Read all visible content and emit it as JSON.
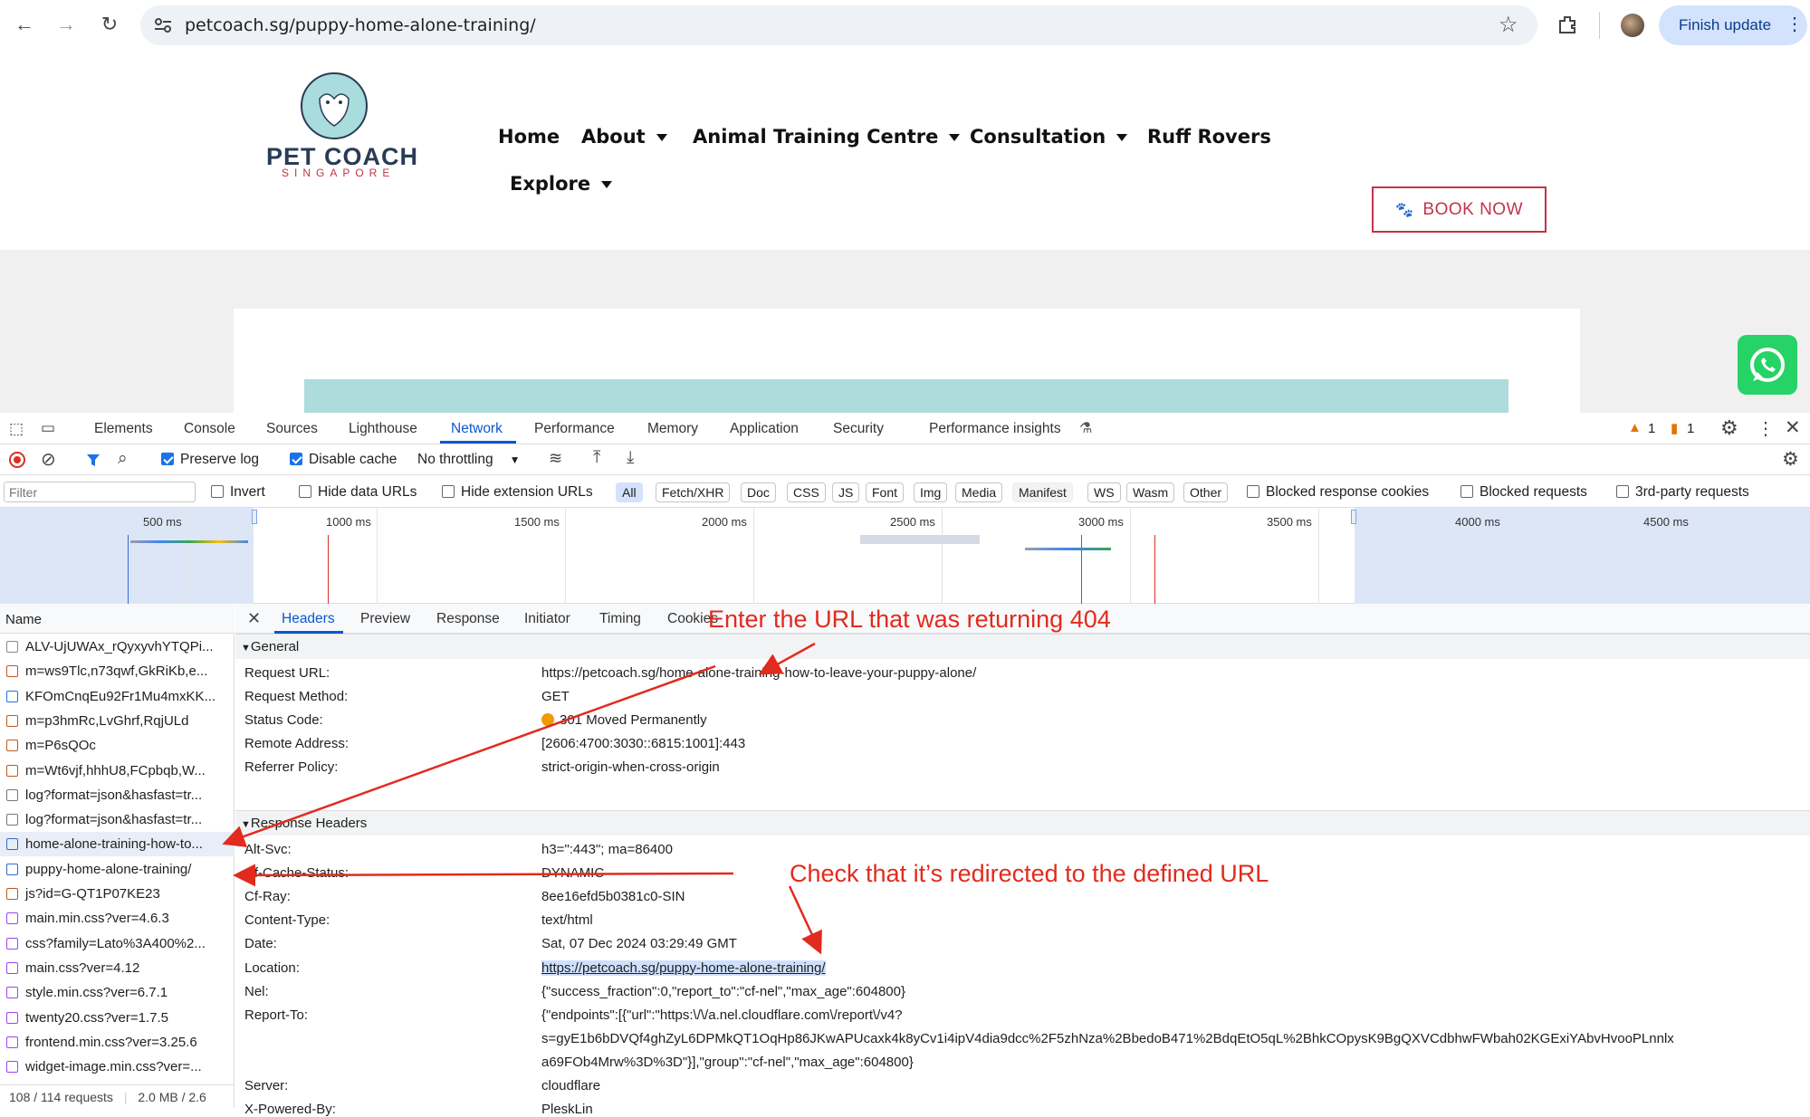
{
  "browser": {
    "url": "petcoach.sg/puppy-home-alone-training/",
    "finish_update_label": "Finish update"
  },
  "site": {
    "logo_text": "PET COACH",
    "logo_subtext": "SINGAPORE",
    "menu": [
      "Home",
      "About",
      "Animal Training Centre",
      "Consultation",
      "Ruff Rovers",
      "Explore"
    ],
    "book_now_label": "BOOK NOW"
  },
  "devtools": {
    "tabs": [
      "Elements",
      "Console",
      "Sources",
      "Lighthouse",
      "Network",
      "Performance",
      "Memory",
      "Application",
      "Security",
      "Performance insights"
    ],
    "active_tab": "Network",
    "warning_count": "1",
    "issue_count": "1",
    "preserve_log_label": "Preserve log",
    "disable_cache_label": "Disable cache",
    "throttling_label": "No throttling",
    "filter_placeholder": "Filter",
    "invert_label": "Invert",
    "hide_data_urls_label": "Hide data URLs",
    "hide_extension_urls_label": "Hide extension URLs",
    "type_filters": [
      "All",
      "Fetch/XHR",
      "Doc",
      "CSS",
      "JS",
      "Font",
      "Img",
      "Media",
      "Manifest",
      "WS",
      "Wasm",
      "Other"
    ],
    "blocked_cookies_label": "Blocked response cookies",
    "blocked_requests_label": "Blocked requests",
    "third_party_label": "3rd-party requests",
    "timeline_ticks": [
      "500 ms",
      "1000 ms",
      "1500 ms",
      "2000 ms",
      "2500 ms",
      "3000 ms",
      "3500 ms",
      "4000 ms",
      "4500 ms"
    ],
    "name_header": "Name",
    "requests": [
      "ALV-UjUWAx_rQyxyvhYTQPi...",
      "m=ws9Tlc,n73qwf,GkRiKb,e...",
      "KFOmCnqEu92Fr1Mu4mxKK...",
      "m=p3hmRc,LvGhrf,RqjULd",
      "m=P6sQOc",
      "m=Wt6vjf,hhhU8,FCpbqb,W...",
      "log?format=json&hasfast=tr...",
      "log?format=json&hasfast=tr...",
      "home-alone-training-how-to...",
      "puppy-home-alone-training/",
      "js?id=G-QT1P07KE23",
      "main.min.css?ver=4.6.3",
      "css?family=Lato%3A400%2...",
      "main.css?ver=4.12",
      "style.min.css?ver=6.7.1",
      "twenty20.css?ver=1.7.5",
      "frontend.min.css?ver=3.25.6",
      "widget-image.min.css?ver=..."
    ],
    "status_bar": {
      "requests": "108 / 114 requests",
      "transferred": "2.0 MB / 2.6"
    },
    "detail_tabs": [
      "Headers",
      "Preview",
      "Response",
      "Initiator",
      "Timing",
      "Cookies"
    ],
    "general_section": "General",
    "general": [
      {
        "key": "Request URL:",
        "value": "https://petcoach.sg/home-alone-training-how-to-leave-your-puppy-alone/"
      },
      {
        "key": "Request Method:",
        "value": "GET"
      },
      {
        "key": "Status Code:",
        "value": "301 Moved Permanently"
      },
      {
        "key": "Remote Address:",
        "value": "[2606:4700:3030::6815:1001]:443"
      },
      {
        "key": "Referrer Policy:",
        "value": "strict-origin-when-cross-origin"
      }
    ],
    "response_section": "Response Headers",
    "response_headers": [
      {
        "key": "Alt-Svc:",
        "value": "h3=\":443\"; ma=86400"
      },
      {
        "key": "Cf-Cache-Status:",
        "value": "DYNAMIC"
      },
      {
        "key": "Cf-Ray:",
        "value": "8ee16efd5b0381c0-SIN"
      },
      {
        "key": "Content-Type:",
        "value": "text/html"
      },
      {
        "key": "Date:",
        "value": "Sat, 07 Dec 2024 03:29:49 GMT"
      },
      {
        "key": "Location:",
        "value": "https://petcoach.sg/puppy-home-alone-training/"
      },
      {
        "key": "Nel:",
        "value": "{\"success_fraction\":0,\"report_to\":\"cf-nel\",\"max_age\":604800}"
      },
      {
        "key": "Report-To:",
        "value": "{\"endpoints\":[{\"url\":\"https:\\/\\/a.nel.cloudflare.com\\/report\\/v4?"
      },
      {
        "key": "",
        "value": "s=gyE1b6bDVQf4ghZyL6DPMkQT1OqHp86JKwAPUcaxk4k8yCv1i4ipV4dia9dcc%2F5zhNza%2BbedoB471%2BdqEtO5qL%2BhkCOpysK9BgQXVCdbhwFWbah02KGExiYAbvHvooPLnnlx"
      },
      {
        "key": "",
        "value": "a69FOb4Mrw%3D%3D\"}],\"group\":\"cf-nel\",\"max_age\":604800}"
      },
      {
        "key": "Server:",
        "value": "cloudflare"
      },
      {
        "key": "X-Powered-By:",
        "value": "PleskLin"
      }
    ]
  },
  "annotations": {
    "top": "Enter the URL that was returning 404",
    "middle": "Check that it’s redirected to the defined URL"
  },
  "colors": {
    "annotation": "#e12b1e",
    "accent": "#1a73e8",
    "brand": "#c2344a"
  }
}
